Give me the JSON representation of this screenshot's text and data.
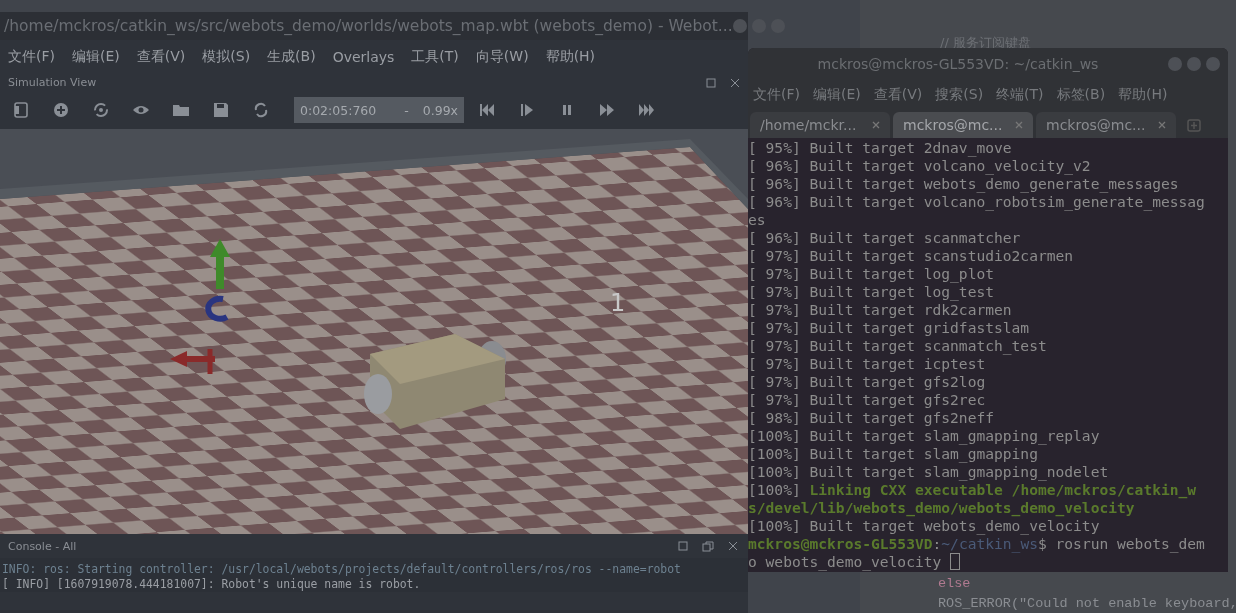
{
  "background_editor": {
    "top_comment": "// 服务订阅键盘",
    "bottom_lines": [
      "else",
      "ROS_ERROR(\"Could not enable keyboard,"
    ]
  },
  "webots": {
    "title": "/home/mckros/catkin_ws/src/webots_demo/worlds/webots_map.wbt (webots_demo) - Webot...",
    "menu": [
      "文件(F)",
      "编辑(E)",
      "查看(V)",
      "模拟(S)",
      "生成(B)",
      "Overlays",
      "工具(T)",
      "向导(W)",
      "帮助(H)"
    ],
    "simulation_view": {
      "title": "Simulation View"
    },
    "toolbar": {
      "time": "0:02:05:760",
      "separator": "-",
      "speed": "0.99x"
    },
    "scene": {
      "label": "1"
    },
    "console": {
      "title": "Console - All",
      "lines": [
        {
          "kind": "info",
          "text": "INFO: ros: Starting controller: /usr/local/webots/projects/default/controllers/ros/ros --name=robot"
        },
        {
          "kind": "output",
          "text": "[ INFO] [1607919078.444181007]: Robot's unique name is robot."
        }
      ]
    }
  },
  "terminal": {
    "title": "mckros@mckros-GL553VD: ~/catkin_ws",
    "menu": [
      "文件(F)",
      "编辑(E)",
      "查看(V)",
      "搜索(S)",
      "终端(T)",
      "标签(B)",
      "帮助(H)"
    ],
    "tabs": [
      {
        "label": "/home/mckr...",
        "selected": false
      },
      {
        "label": "mckros@mc...",
        "selected": true
      },
      {
        "label": "mckros@mc...",
        "selected": false
      }
    ],
    "lines": [
      {
        "kind": "plain",
        "text": "[ 95%] Built target 2dnav_move"
      },
      {
        "kind": "plain",
        "text": "[ 96%] Built target volcano_velocity_v2"
      },
      {
        "kind": "plain",
        "text": "[ 96%] Built target webots_demo_generate_messages"
      },
      {
        "kind": "plain",
        "text": "[ 96%] Built target volcano_robotsim_generate_messages"
      },
      {
        "kind": "plain",
        "text": "[ 96%] Built target scanmatcher"
      },
      {
        "kind": "plain",
        "text": "[ 97%] Built target scanstudio2carmen"
      },
      {
        "kind": "plain",
        "text": "[ 97%] Built target log_plot"
      },
      {
        "kind": "plain",
        "text": "[ 97%] Built target log_test"
      },
      {
        "kind": "plain",
        "text": "[ 97%] Built target rdk2carmen"
      },
      {
        "kind": "plain",
        "text": "[ 97%] Built target gridfastslam"
      },
      {
        "kind": "plain",
        "text": "[ 97%] Built target scanmatch_test"
      },
      {
        "kind": "plain",
        "text": "[ 97%] Built target icptest"
      },
      {
        "kind": "plain",
        "text": "[ 97%] Built target gfs2log"
      },
      {
        "kind": "plain",
        "text": "[ 97%] Built target gfs2rec"
      },
      {
        "kind": "plain",
        "text": "[ 98%] Built target gfs2neff"
      },
      {
        "kind": "plain",
        "text": "[100%] Built target slam_gmapping_replay"
      },
      {
        "kind": "plain",
        "text": "[100%] Built target slam_gmapping"
      },
      {
        "kind": "plain",
        "text": "[100%] Built target slam_gmapping_nodelet"
      },
      {
        "kind": "linking",
        "prefix": "[100%] ",
        "text": "Linking CXX executable /home/mckros/catkin_ws/devel/lib/webots_demo/webots_demo_velocity"
      },
      {
        "kind": "plain",
        "text": "[100%] Built target webots_demo_velocity"
      },
      {
        "kind": "prompt",
        "user": "mckros@mckros-GL553VD",
        "sep": ":",
        "path": "~/catkin_ws",
        "text": "$ rosrun webots_demo webots_demo_velocity"
      }
    ]
  }
}
